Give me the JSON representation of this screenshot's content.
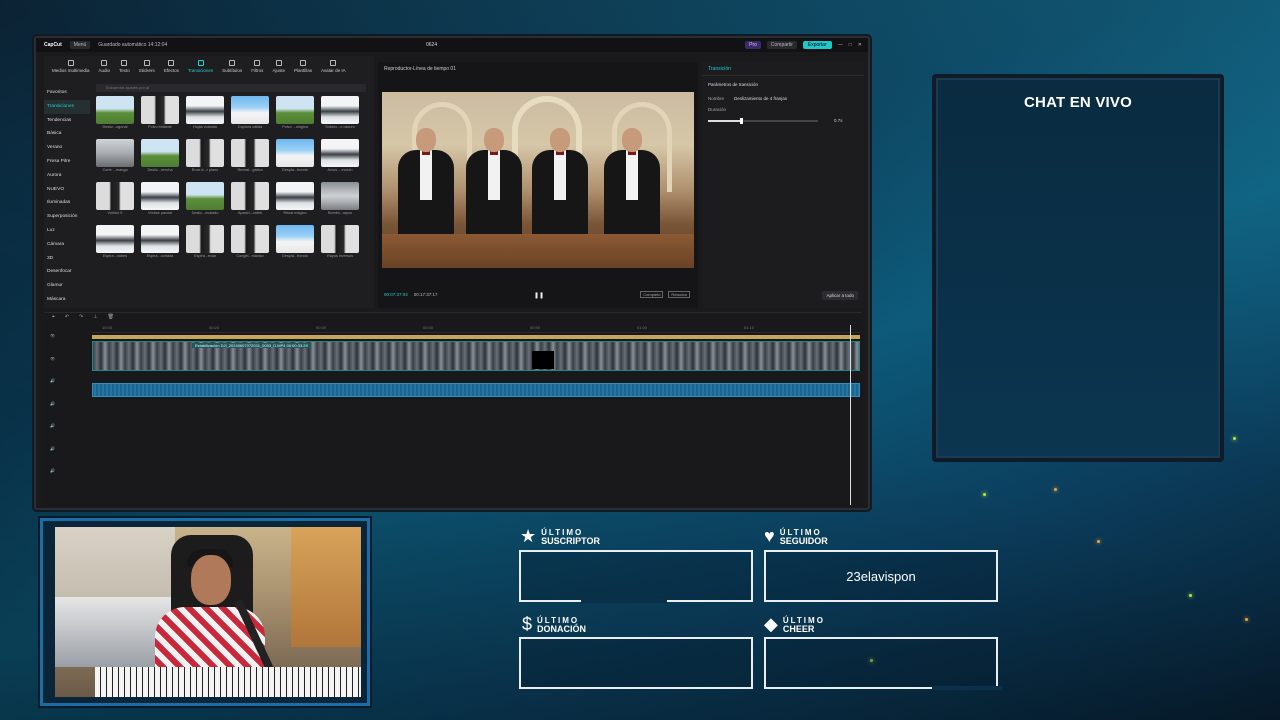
{
  "app": {
    "logo": "CapCut",
    "menu": "Menú",
    "autosave": "Guardado automático 14:12:04",
    "project_title": "0624",
    "pro": "Pro",
    "share": "Compartir",
    "export": "Exportar"
  },
  "media_tabs": [
    "Medios multimedia",
    "Audio",
    "Texto",
    "Stickers",
    "Efectos",
    "Transiciones",
    "Subtítulos",
    "Filtros",
    "Ajuste",
    "Plantillas",
    "Avatar de IA"
  ],
  "media_active_tab": "Transiciones",
  "left_nav": [
    "Favoritos",
    "Transiciones",
    "Tendencias",
    "Básica",
    "Verano",
    "Fresa Pitre",
    "Aurora",
    "NUEVO",
    "Iluminadas",
    "Superposición",
    "Luz",
    "Cámara",
    "3D",
    "Desenfocar",
    "Glamur",
    "Máscara"
  ],
  "search_placeholder": "Encuentra ajustes por ai",
  "tiles": [
    {
      "label": "Desliz...ogonal",
      "style": "t-grn"
    },
    {
      "label": "Polvo brillante",
      "style": "t-ppl"
    },
    {
      "label": "Hojas volando",
      "style": "t-mtn"
    },
    {
      "label": "Captura cálida",
      "style": "t-blu"
    },
    {
      "label": "Polvo ...ológica",
      "style": "t-grn"
    },
    {
      "label": "Sobrec...o oscuro",
      "style": "t-mtn"
    },
    {
      "label": "Corte ...manga",
      "style": "t-car"
    },
    {
      "label": "Deslic...erecha",
      "style": "t-grn"
    },
    {
      "label": "Error d...r plano",
      "style": "t-ppl"
    },
    {
      "label": "Reveal...gática",
      "style": "t-ppl"
    },
    {
      "label": "Despla...frondo",
      "style": "t-blu"
    },
    {
      "label": "Arcos ...ección",
      "style": "t-mtn"
    },
    {
      "label": "Vórtice II",
      "style": "t-ppl"
    },
    {
      "label": "Vórtice parcial",
      "style": "t-mtn"
    },
    {
      "label": "Desliz...ovalado",
      "style": "t-grn"
    },
    {
      "label": "Aparici...onfeti",
      "style": "t-ppl"
    },
    {
      "label": "Ritual mágico",
      "style": "t-mtn"
    },
    {
      "label": "Bombil...rayos",
      "style": "t-gst"
    },
    {
      "label": "Espira...nubes",
      "style": "t-mtn"
    },
    {
      "label": "Espira...cortada",
      "style": "t-mtn"
    },
    {
      "label": "Espira...ecial",
      "style": "t-ppl"
    },
    {
      "label": "Congel...máxico",
      "style": "t-ppl"
    },
    {
      "label": "Despla...frondo",
      "style": "t-blu"
    },
    {
      "label": "Rayos inversos",
      "style": "t-ppl"
    }
  ],
  "preview": {
    "header": "Reproductor-Línea de tiempo 01",
    "current_time": "00:07:37:04",
    "total_time": "00:17:37:17",
    "ratio_a": "Completo",
    "ratio_b": "Relación"
  },
  "props": {
    "header": "Transición",
    "section": "Parámetros de transición",
    "name_label": "Nombre",
    "name_value": "Deslizamiento de 4 franjas",
    "duration_label": "Duración",
    "duration_value": "0.7s",
    "duration_fraction": 0.3,
    "apply_all": "Aplicar a todo"
  },
  "timeline": {
    "ruler": [
      "10:00",
      "00:20",
      "00:30",
      "00:40",
      "00:50",
      "01:00",
      "01:10"
    ],
    "clip_label": "Estabilización  DJI_20240607072031_0053_D.MP4  00:00:33:29"
  },
  "chat": {
    "title": "CHAT EN VIVO"
  },
  "alerts": {
    "sub": {
      "top": "ÚLTIMO",
      "bottom": "SUSCRIPTOR",
      "value": ""
    },
    "follower": {
      "top": "ÚLTIMO",
      "bottom": "SEGUIDOR",
      "value": "23elavispon"
    },
    "donation": {
      "top": "ÚLTIMO",
      "bottom": "DONACIÓN",
      "value": ""
    },
    "cheer": {
      "top": "ÚLTIMO",
      "bottom": "CHEER",
      "value": ""
    }
  },
  "icons": {
    "sub": "star-icon",
    "follower": "heart-icon",
    "donation": "dollar-icon",
    "cheer": "diamond-icon"
  },
  "colors": {
    "accent": "#1fd0d0",
    "overlay_bg": "#0b3d5c",
    "spark": "#b7e53a"
  }
}
